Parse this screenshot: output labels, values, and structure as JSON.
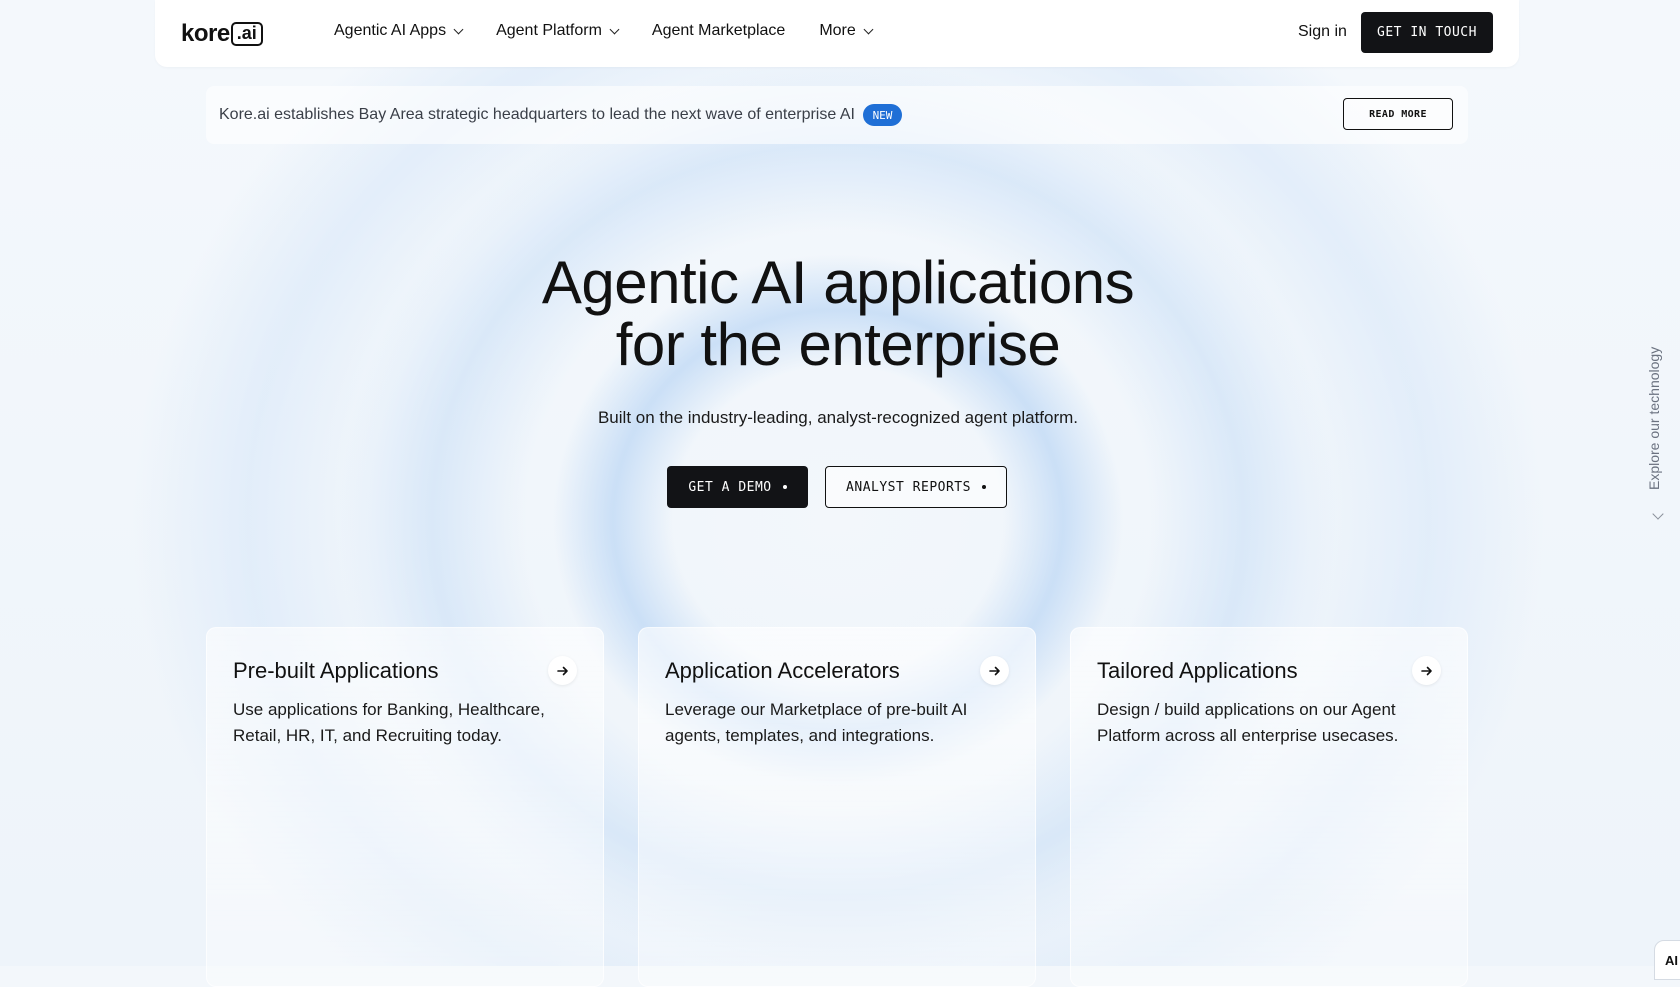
{
  "navbar": {
    "logo_text": "kore",
    "logo_box": ".ai",
    "items": [
      {
        "label": "Agentic AI Apps",
        "has_dropdown": true
      },
      {
        "label": "Agent Platform",
        "has_dropdown": true
      },
      {
        "label": "Agent Marketplace",
        "has_dropdown": false
      },
      {
        "label": "More",
        "has_dropdown": true
      }
    ],
    "signin": "Sign in",
    "cta": "GET IN TOUCH"
  },
  "announcement": {
    "text": "Kore.ai establishes Bay Area strategic headquarters to lead the next wave of enterprise AI",
    "badge": "NEW",
    "button": "READ MORE"
  },
  "hero": {
    "title_line1": "Agentic AI applications",
    "title_line2": "for the enterprise",
    "subtitle": "Built on the industry-leading, analyst-recognized agent platform.",
    "primary_button": "GET A DEMO",
    "secondary_button": "ANALYST REPORTS"
  },
  "side": {
    "explore": "Explore our technology"
  },
  "cards": [
    {
      "title": "Pre-built Applications",
      "description": "Use applications for Banking, Healthcare, Retail, HR, IT, and Recruiting today."
    },
    {
      "title": "Application Accelerators",
      "description": "Leverage our Marketplace of pre-built AI agents, templates, and integrations."
    },
    {
      "title": "Tailored Applications",
      "description": "Design / build applications on our Agent Platform across all enterprise usecases."
    }
  ],
  "widget": {
    "label": "AI"
  },
  "colors": {
    "accent_blue": "#1f6fd6",
    "button_dark": "#121316",
    "background": "#f3f7fb"
  }
}
